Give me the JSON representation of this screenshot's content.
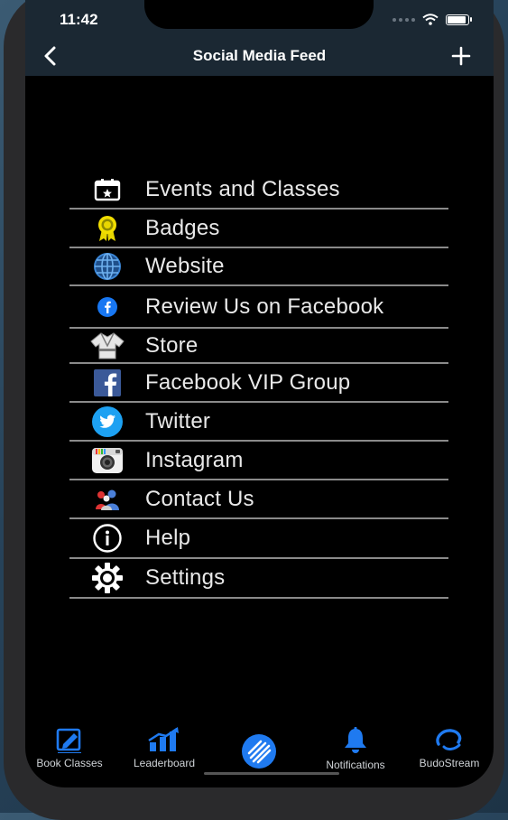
{
  "status_bar": {
    "time": "11:42"
  },
  "nav": {
    "title": "Social Media Feed",
    "back_icon": "chevron-left-icon",
    "add_icon": "plus-icon"
  },
  "menu": {
    "items": [
      {
        "label": "Events and Classes",
        "icon": "calendar-icon"
      },
      {
        "label": "Badges",
        "icon": "badge-icon"
      },
      {
        "label": "Website",
        "icon": "globe-icon"
      },
      {
        "label": "Review Us on Facebook",
        "icon": "facebook-circle-icon"
      },
      {
        "label": "Store",
        "icon": "gi-uniform-icon"
      },
      {
        "label": "Facebook VIP Group",
        "icon": "facebook-square-icon"
      },
      {
        "label": "Twitter",
        "icon": "twitter-icon"
      },
      {
        "label": "Instagram",
        "icon": "instagram-icon"
      },
      {
        "label": "Contact Us",
        "icon": "contacts-icon"
      },
      {
        "label": "Help",
        "icon": "info-icon"
      },
      {
        "label": "Settings",
        "icon": "gear-icon"
      }
    ]
  },
  "tabbar": {
    "accent": "#1f7af0",
    "tabs": [
      {
        "label": "Book Classes",
        "icon": "book-classes-icon"
      },
      {
        "label": "Leaderboard",
        "icon": "leaderboard-icon"
      },
      {
        "label": "",
        "icon": "home-stripes-icon"
      },
      {
        "label": "Notifications",
        "icon": "bell-icon"
      },
      {
        "label": "BudoStream",
        "icon": "budostream-icon"
      }
    ]
  }
}
